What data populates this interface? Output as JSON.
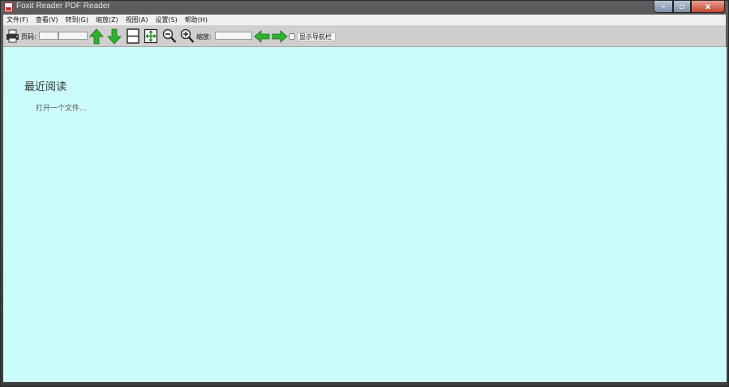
{
  "window": {
    "title": "Foxit Reader PDF Reader",
    "caption": {
      "minimize": "–",
      "maximize": "▫",
      "close": "x"
    }
  },
  "menu": [
    "文件(F)",
    "查看(V)",
    "转到(G)",
    "缩放(Z)",
    "视图(A)",
    "设置(S)",
    "帮助(H)"
  ],
  "toolbar": {
    "page_label": "页码:",
    "page_value": "",
    "page_total": "",
    "zoom_label": "缩放:",
    "zoom_value": "",
    "checkbox_label": "显示导航栏"
  },
  "content": {
    "recent_title": "最近阅读",
    "open_file_link": "打开一个文件..."
  },
  "colors": {
    "content_bg": "#ccfdfd",
    "toolbar_bg": "#cfcfcf",
    "arrow_green": "#2db32d"
  }
}
